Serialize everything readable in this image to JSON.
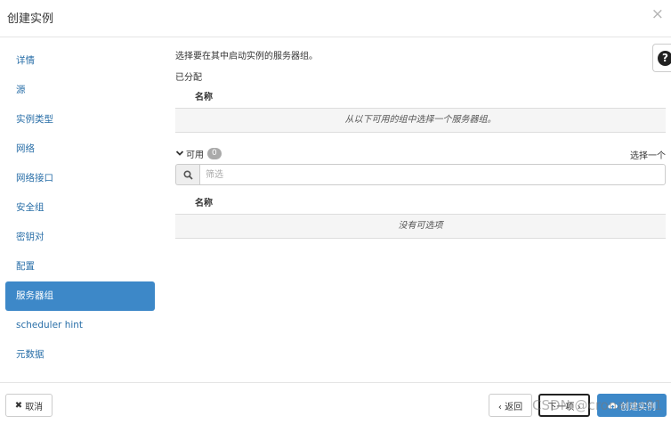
{
  "modal": {
    "title": "创建实例",
    "close_glyph": "×"
  },
  "sidebar": {
    "active_index": 8,
    "items": [
      {
        "label": "详情"
      },
      {
        "label": "源"
      },
      {
        "label": "实例类型"
      },
      {
        "label": "网络"
      },
      {
        "label": "网络接口"
      },
      {
        "label": "安全组"
      },
      {
        "label": "密钥对"
      },
      {
        "label": "配置"
      },
      {
        "label": "服务器组"
      },
      {
        "label": "scheduler hint"
      },
      {
        "label": "元数据"
      }
    ]
  },
  "main": {
    "description": "选择要在其中启动实例的服务器组。",
    "allocated": {
      "title": "已分配",
      "column_name": "名称",
      "empty_message": "从以下可用的组中选择一个服务器组。"
    },
    "available": {
      "title": "可用",
      "count": "0",
      "select_hint": "选择一个",
      "search_placeholder": "筛选",
      "search_value": "",
      "column_name": "名称",
      "empty_message": "没有可选项"
    }
  },
  "help": {
    "glyph": "?"
  },
  "footer": {
    "cancel_label": "取消",
    "back_label": "‹ 返回",
    "next_label": "下一项 ›",
    "create_label": "创建实例"
  },
  "watermark": "CSDN @cronaldo91",
  "colors": {
    "accent": "#3d88c8",
    "link": "#2a6fa8",
    "row_bg": "#f5f5f5"
  },
  "icons": [
    "close-icon",
    "question-icon",
    "chevron-down-icon",
    "search-icon",
    "times-icon",
    "cloud-upload-icon"
  ]
}
